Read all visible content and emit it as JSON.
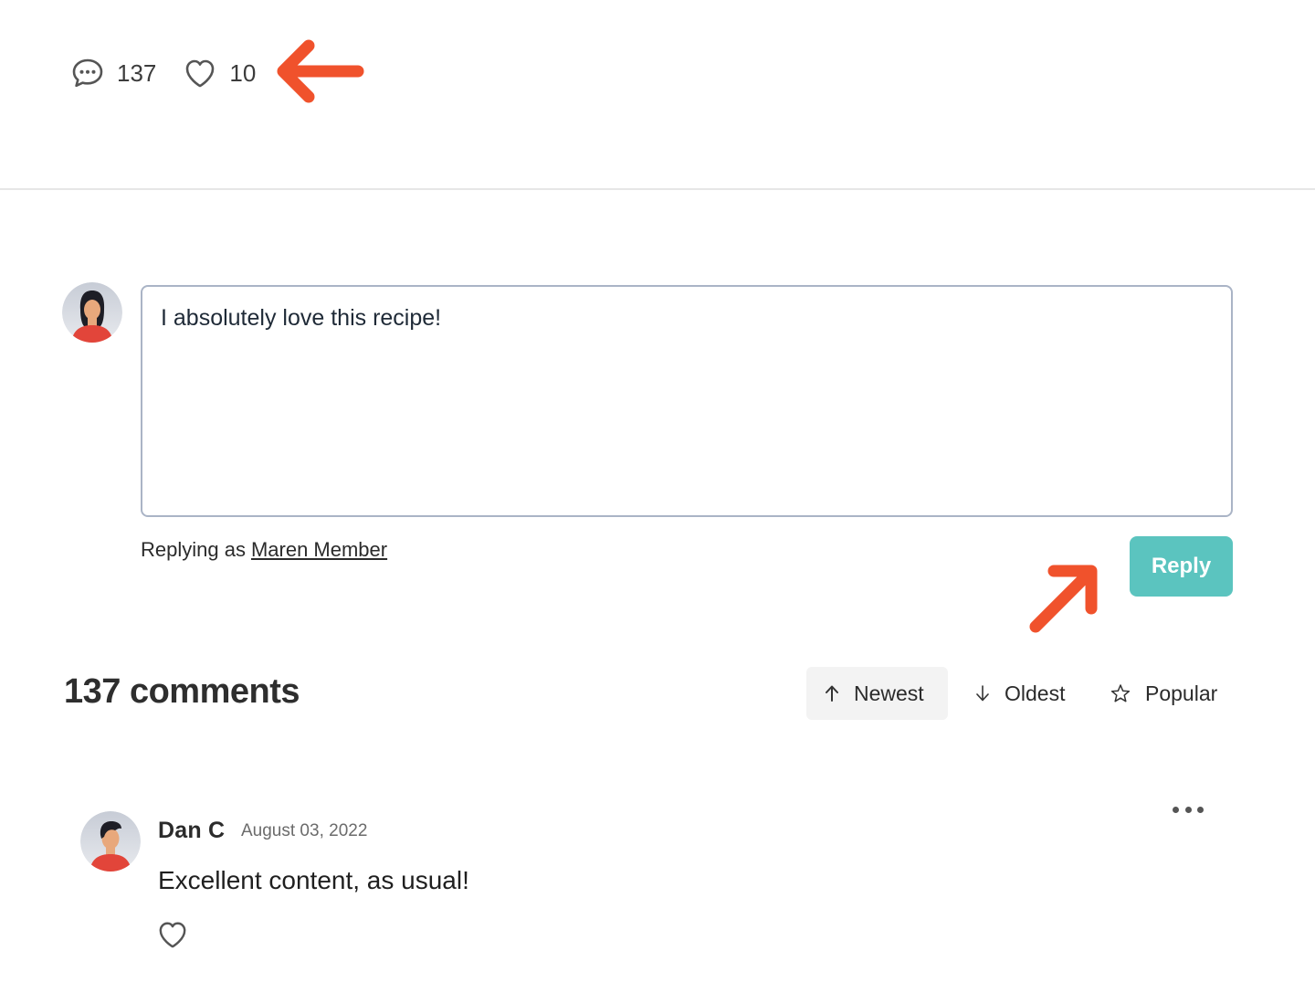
{
  "stats": {
    "comments_count": "137",
    "likes_count": "10"
  },
  "composer": {
    "value": "I absolutely love this recipe!",
    "replying_prefix": "Replying as",
    "replying_user": "Maren Member",
    "reply_label": "Reply"
  },
  "comments_section": {
    "title": "137 comments",
    "sort_options": [
      {
        "label": "Newest",
        "icon": "arrow-up-icon",
        "active": true
      },
      {
        "label": "Oldest",
        "icon": "arrow-down-icon",
        "active": false
      },
      {
        "label": "Popular",
        "icon": "star-icon",
        "active": false
      }
    ],
    "comments": [
      {
        "author": "Dan C",
        "date": "August 03, 2022",
        "text": "Excellent content, as usual!"
      }
    ]
  },
  "colors": {
    "accent": "#5bc4bf",
    "annotation_arrow": "#f0522c",
    "avatar_shirt": "#e2453a"
  }
}
